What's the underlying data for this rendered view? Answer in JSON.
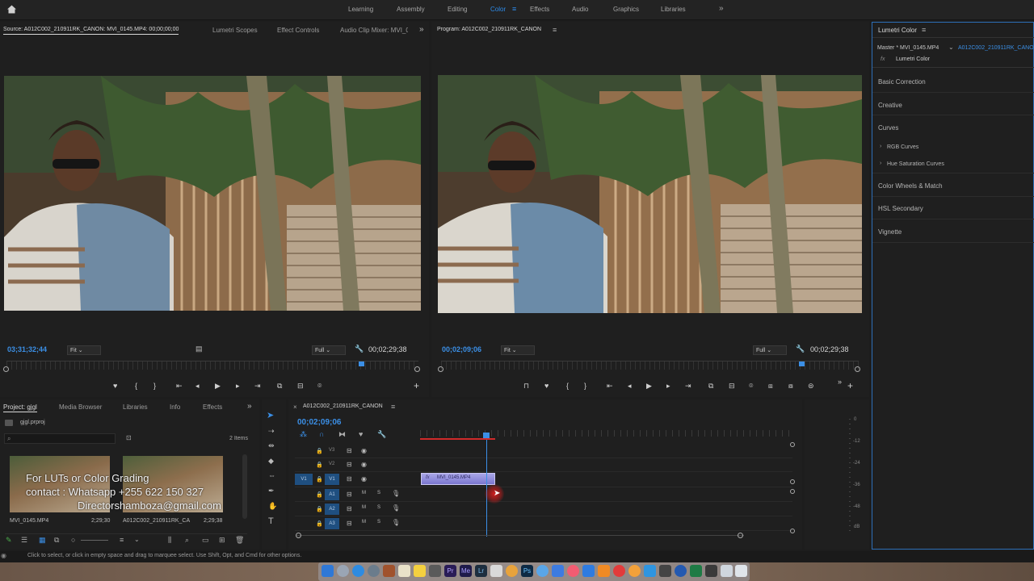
{
  "topbar": {
    "workspaces": [
      "Learning",
      "Assembly",
      "Editing",
      "Color",
      "Effects",
      "Audio",
      "Graphics",
      "Libraries"
    ],
    "active": "Color",
    "more": "»"
  },
  "source": {
    "tabs": [
      "Source: A012C002_210911RK_CANON: MVI_0145.MP4: 00;00;00;00",
      "Lumetri Scopes",
      "Effect Controls",
      "Audio Clip Mixer: MVI_0"
    ],
    "timecode": "03;31;32;44",
    "fit": "Fit",
    "quality": "Full",
    "duration": "00;02;29;38"
  },
  "program": {
    "title": "Program: A012C002_210911RK_CANON",
    "timecode": "00;02;09;06",
    "fit": "Fit",
    "quality": "Full",
    "duration": "00;02;29;38"
  },
  "lumetri": {
    "title": "Lumetri Color",
    "master": "Master * MVI_0145.MP4",
    "seq": "A012C002_210911RK_CANO",
    "fx": "Lumetri Color",
    "sections": [
      "Basic Correction",
      "Creative",
      "Curves",
      "Color Wheels & Match",
      "HSL Secondary",
      "Vignette"
    ],
    "subsections": [
      "RGB Curves",
      "Hue Saturation Curves"
    ]
  },
  "project": {
    "tabs": [
      "Project: gjgl",
      "Media Browser",
      "Libraries",
      "Info",
      "Effects"
    ],
    "file": "gjgl.prproj",
    "count": "2 Items",
    "items": [
      {
        "name": "MVI_0145.MP4",
        "duration": "2;29;30"
      },
      {
        "name": "A012C002_210911RK_CA",
        "duration": "2;29;38"
      }
    ],
    "overlay": [
      "For LUTs or Color Grading",
      "contact : Whatsapp +255 622 150 327",
      "Directorshamboza@gmail.com"
    ]
  },
  "timeline": {
    "tab": "A012C002_210911RK_CANON",
    "timecode": "00;02;09;06",
    "tracks": [
      "V3",
      "V2",
      "V1",
      "A1",
      "A2",
      "A3"
    ],
    "src_patch": "V1",
    "clip": "MVI_0145.MP4"
  },
  "meter": {
    "ticks": [
      "0",
      "-12",
      "-24",
      "-36",
      "-48",
      "dB"
    ]
  },
  "status": "Click to select, or click in empty space and drag to marquee select. Use Shift, Opt, and Cmd for other options.",
  "colors": {
    "accent": "#2d8ceb",
    "clip": "#8f8bdc",
    "playhead": "#3b8fe6"
  }
}
